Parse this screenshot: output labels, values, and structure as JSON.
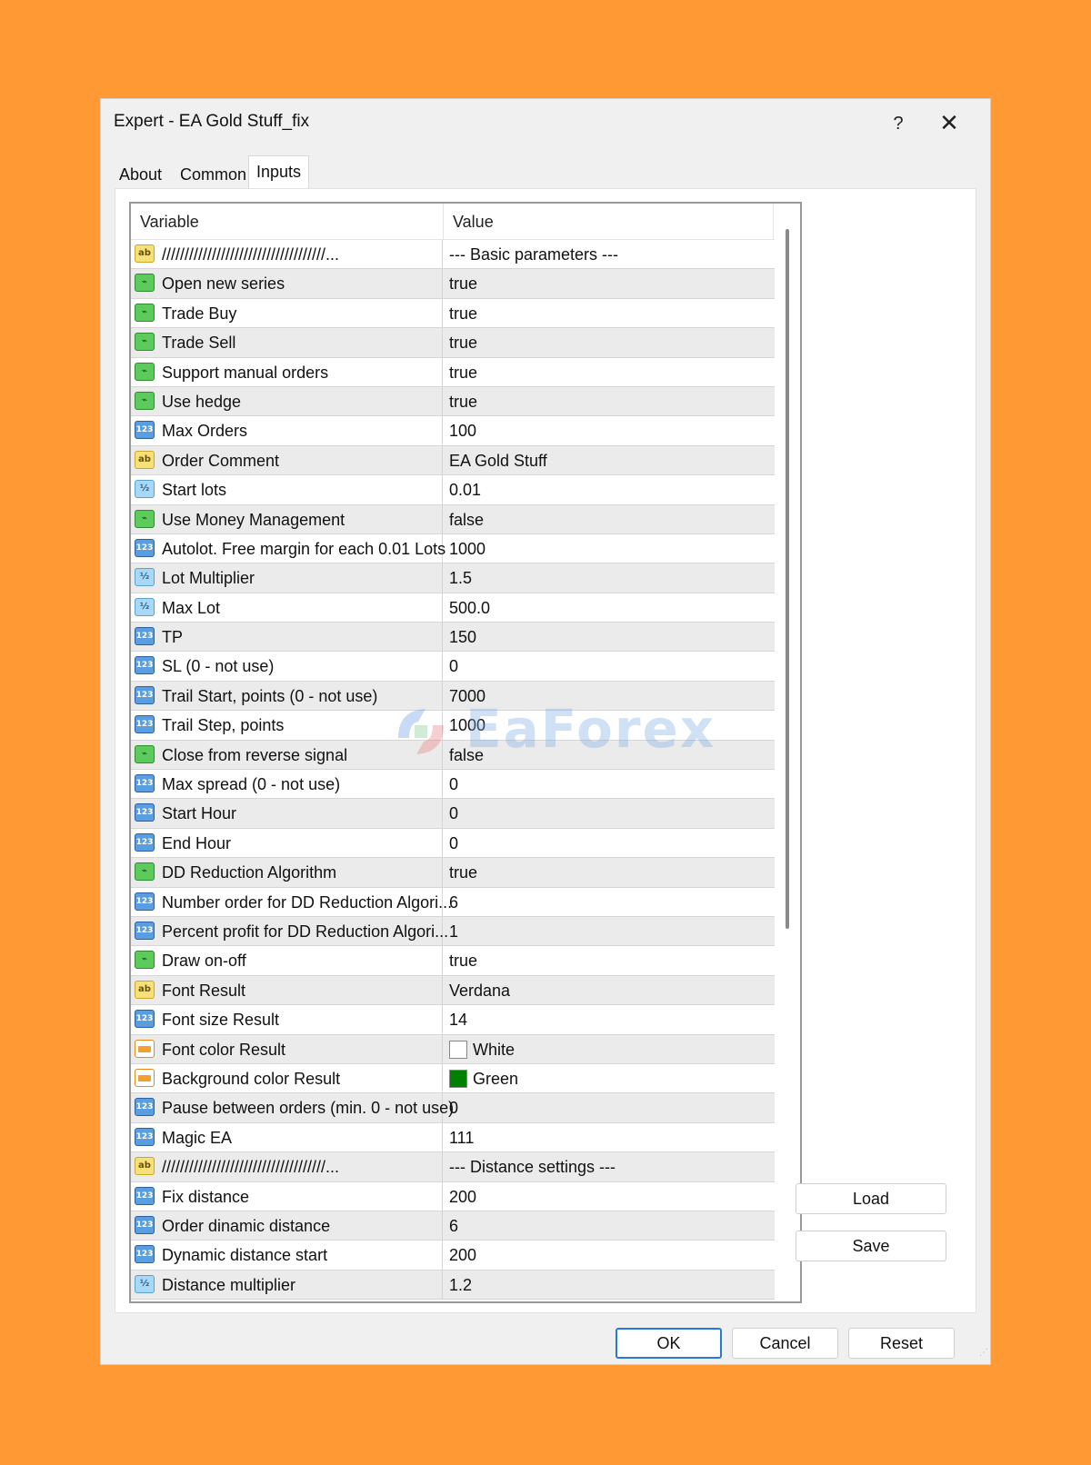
{
  "window": {
    "title": "Expert - EA Gold Stuff_fix",
    "help_label": "?",
    "close_label": "✕"
  },
  "tabs": [
    {
      "label": "About"
    },
    {
      "label": "Common"
    },
    {
      "label": "Inputs"
    }
  ],
  "grid": {
    "header_variable": "Variable",
    "header_value": "Value",
    "rows": [
      {
        "icon": "string-type-icon",
        "name": "////////////////////////////////////...",
        "value": "--- Basic parameters ---"
      },
      {
        "icon": "bool-type-icon",
        "name": "Open new series",
        "value": "true"
      },
      {
        "icon": "bool-type-icon",
        "name": "Trade Buy",
        "value": "true"
      },
      {
        "icon": "bool-type-icon",
        "name": "Trade Sell",
        "value": "true"
      },
      {
        "icon": "bool-type-icon",
        "name": "Support manual orders",
        "value": "true"
      },
      {
        "icon": "bool-type-icon",
        "name": "Use hedge",
        "value": "true"
      },
      {
        "icon": "int-type-icon",
        "name": "Max Orders",
        "value": "100"
      },
      {
        "icon": "string-type-icon",
        "name": "Order Comment",
        "value": "EA Gold Stuff"
      },
      {
        "icon": "double-type-icon",
        "name": "Start lots",
        "value": "0.01"
      },
      {
        "icon": "bool-type-icon",
        "name": "Use Money Management",
        "value": "false"
      },
      {
        "icon": "int-type-icon",
        "name": "Autolot. Free margin for each 0.01 Lots",
        "value": "1000"
      },
      {
        "icon": "double-type-icon",
        "name": "Lot Multiplier",
        "value": "1.5"
      },
      {
        "icon": "double-type-icon",
        "name": "Max Lot",
        "value": "500.0"
      },
      {
        "icon": "int-type-icon",
        "name": "TP",
        "value": "150"
      },
      {
        "icon": "int-type-icon",
        "name": "SL (0 - not use)",
        "value": "0"
      },
      {
        "icon": "int-type-icon",
        "name": "Trail Start, points (0 - not use)",
        "value": "7000"
      },
      {
        "icon": "int-type-icon",
        "name": "Trail Step, points",
        "value": "1000"
      },
      {
        "icon": "bool-type-icon",
        "name": "Close from reverse signal",
        "value": "false"
      },
      {
        "icon": "int-type-icon",
        "name": "Max spread (0 - not use)",
        "value": "0"
      },
      {
        "icon": "int-type-icon",
        "name": "Start Hour",
        "value": "0"
      },
      {
        "icon": "int-type-icon",
        "name": "End Hour",
        "value": "0"
      },
      {
        "icon": "bool-type-icon",
        "name": "DD Reduction Algorithm",
        "value": "true"
      },
      {
        "icon": "int-type-icon",
        "name": "Number order for DD Reduction Algori...",
        "value": "6"
      },
      {
        "icon": "int-type-icon",
        "name": "Percent profit for DD Reduction Algori...",
        "value": "1"
      },
      {
        "icon": "bool-type-icon",
        "name": "Draw on-off",
        "value": "true"
      },
      {
        "icon": "string-type-icon",
        "name": "Font Result",
        "value": "Verdana"
      },
      {
        "icon": "int-type-icon",
        "name": "Font size Result",
        "value": "14"
      },
      {
        "icon": "color-type-icon",
        "name": "Font color Result",
        "value": "White",
        "swatch": "#FFFFFF"
      },
      {
        "icon": "color-type-icon",
        "name": "Background color Result",
        "value": "Green",
        "swatch": "#008000"
      },
      {
        "icon": "int-type-icon",
        "name": "Pause between orders (min. 0 - not use)",
        "value": "0"
      },
      {
        "icon": "int-type-icon",
        "name": "Magic EA",
        "value": "111"
      },
      {
        "icon": "string-type-icon",
        "name": "////////////////////////////////////...",
        "value": "--- Distance settings ---"
      },
      {
        "icon": "int-type-icon",
        "name": "Fix distance",
        "value": "200"
      },
      {
        "icon": "int-type-icon",
        "name": "Order dinamic distance",
        "value": "6"
      },
      {
        "icon": "int-type-icon",
        "name": "Dynamic distance start",
        "value": "200"
      },
      {
        "icon": "double-type-icon",
        "name": "Distance multiplier",
        "value": "1.2"
      }
    ]
  },
  "side_buttons": {
    "load": "Load",
    "save": "Save"
  },
  "footer_buttons": {
    "ok": "OK",
    "cancel": "Cancel",
    "reset": "Reset"
  },
  "watermark": {
    "text": "EaForex"
  },
  "colors": {
    "background": "#FF9933",
    "ok_border": "#2B79D6"
  }
}
